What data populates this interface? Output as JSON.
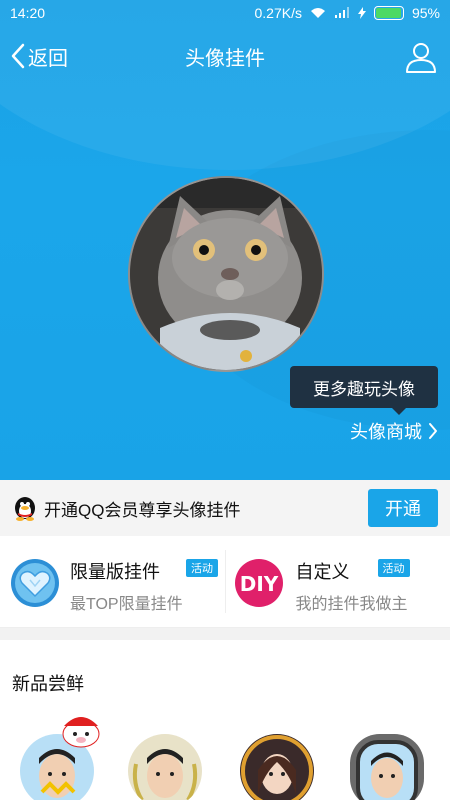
{
  "status_bar": {
    "time": "14:20",
    "network_speed": "0.27K/s",
    "battery": "95%",
    "battery_level": 0.95
  },
  "nav": {
    "back_label": "返回",
    "title": "头像挂件",
    "icons": {
      "back": "chevron-left-icon",
      "profile": "user-icon"
    }
  },
  "hero": {
    "tooltip": "更多趣玩头像",
    "shop_link": "头像商城"
  },
  "vip": {
    "text": "开通QQ会员尊享头像挂件",
    "button": "开通"
  },
  "features": [
    {
      "title": "限量版挂件",
      "badge": "活动",
      "subtitle": "最TOP限量挂件"
    },
    {
      "title": "自定义",
      "badge": "活动",
      "subtitle": "我的挂件我做主",
      "icon_text": "DIY"
    }
  ],
  "new_section": {
    "title": "新品尝鲜"
  },
  "colors": {
    "primary": "#1aa5e8",
    "tooltip_bg": "#1f3142",
    "diy_pink": "#e0206a"
  }
}
